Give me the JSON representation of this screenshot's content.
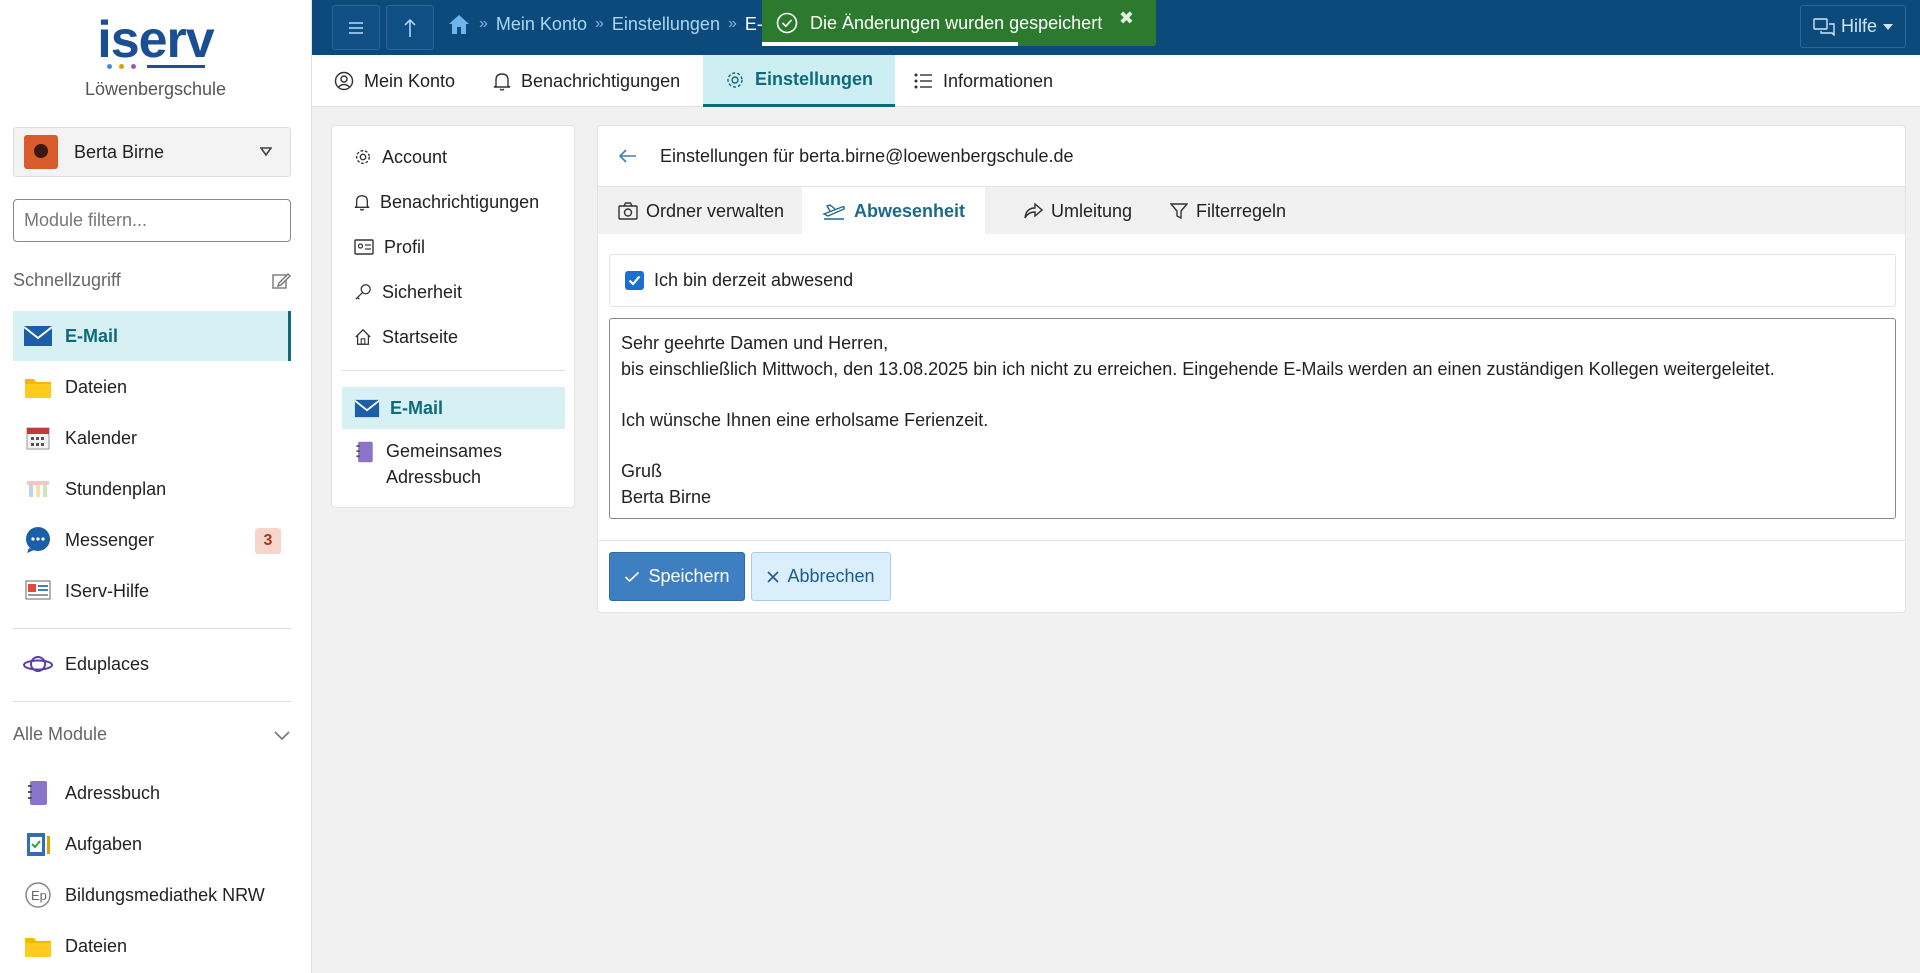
{
  "brand": {
    "logo_text": "iserv",
    "school": "Löwenbergschule"
  },
  "user": {
    "name": "Berta Birne"
  },
  "sidebar": {
    "filter_placeholder": "Module filtern...",
    "quick_access_label": "Schnellzugriff",
    "quick_items": [
      {
        "label": "E-Mail",
        "icon": "mail-icon",
        "active": true
      },
      {
        "label": "Dateien",
        "icon": "folder-icon"
      },
      {
        "label": "Kalender",
        "icon": "calendar-icon"
      },
      {
        "label": "Stundenplan",
        "icon": "timetable-icon"
      },
      {
        "label": "Messenger",
        "icon": "chat-icon",
        "badge": "3"
      },
      {
        "label": "IServ-Hilfe",
        "icon": "help-icon"
      }
    ],
    "extra_item": {
      "label": "Eduplaces",
      "icon": "planet-icon"
    },
    "all_modules_label": "Alle Module",
    "all_modules": [
      {
        "label": "Adressbuch",
        "icon": "addressbook-icon"
      },
      {
        "label": "Aufgaben",
        "icon": "tasks-icon"
      },
      {
        "label": "Bildungsmediathek NRW",
        "icon": "ep-icon"
      },
      {
        "label": "Dateien",
        "icon": "folder-icon"
      }
    ]
  },
  "header": {
    "breadcrumb": [
      "Mein Konto",
      "Einstellungen",
      "E-M"
    ],
    "help_label": "Hilfe"
  },
  "toast": {
    "message": "Die Änderungen wurden gespeichert",
    "close_symbol": "✖",
    "progress": 0.65
  },
  "top_tabs": [
    {
      "label": "Mein Konto",
      "icon": "user-circle-icon"
    },
    {
      "label": "Benachrichtigungen",
      "icon": "bell-icon"
    },
    {
      "label": "Einstellungen",
      "icon": "gear-icon",
      "active": true
    },
    {
      "label": "Informationen",
      "icon": "list-icon"
    }
  ],
  "settings_menu": {
    "items": [
      {
        "label": "Account",
        "icon": "gear-icon"
      },
      {
        "label": "Benachrichtigungen",
        "icon": "bell-icon"
      },
      {
        "label": "Profil",
        "icon": "id-card-icon"
      },
      {
        "label": "Sicherheit",
        "icon": "key-icon"
      },
      {
        "label": "Startseite",
        "icon": "home-icon"
      }
    ],
    "module_items": [
      {
        "label": "E-Mail",
        "icon": "mail-icon",
        "active": true
      },
      {
        "label": "Gemeinsames Adressbuch",
        "label_line1": "Gemeinsames",
        "label_line2": "Adressbuch",
        "icon": "addressbook-icon"
      }
    ]
  },
  "main": {
    "title": "Einstellungen für berta.birne@loewenbergschule.de",
    "tabs": [
      {
        "label": "Ordner verwalten",
        "icon": "camera-icon"
      },
      {
        "label": "Abwesenheit",
        "icon": "plane-icon",
        "active": true
      },
      {
        "label": "Umleitung",
        "icon": "share-icon"
      },
      {
        "label": "Filterregeln",
        "icon": "filter-icon"
      }
    ],
    "absent_checkbox_label": "Ich bin derzeit abwesend",
    "absent_checked": true,
    "message": "Sehr geehrte Damen und Herren,\nbis einschließlich Mittwoch, den 13.08.2025 bin ich nicht zu erreichen. Eingehende E-Mails werden an einen zuständigen Kollegen weitergeleitet.\n\nIch wünsche Ihnen eine erholsame Ferienzeit.\n\nGruß\nBerta Birne",
    "save_label": "Speichern",
    "cancel_label": "Abbrechen"
  },
  "colors": {
    "header": "#0d4a7c",
    "accent": "#0f6b7a",
    "toast": "#2b7a2e",
    "primary_button": "#3d7fc0"
  }
}
